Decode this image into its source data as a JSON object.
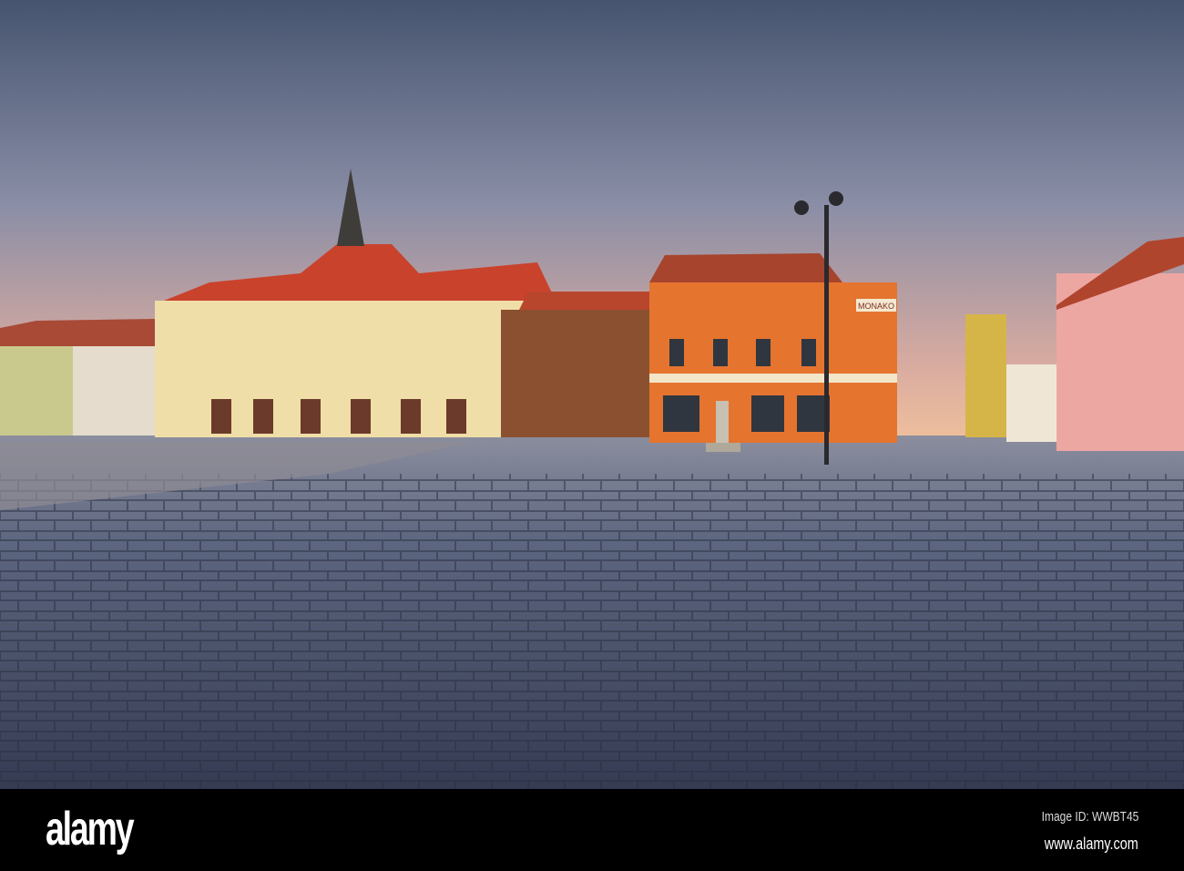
{
  "photo": {
    "shop_sign": "MONAKO",
    "watermark": "alamy"
  },
  "footer": {
    "logo": "alamy",
    "image_id": "Image ID: WWBT45",
    "url": "www.alamy.com"
  }
}
